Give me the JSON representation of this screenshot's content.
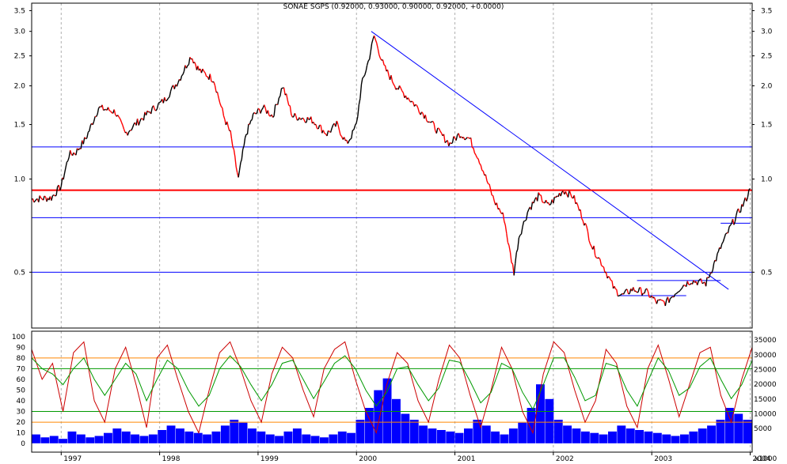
{
  "title": "SONAE SGPS (0.92000, 0.93000, 0.90000, 0.92000, +0.0000)",
  "colors": {
    "price_up": "#000000",
    "price_down": "#ff0000",
    "trendline": "#0000ff",
    "resistance": "#ff0000",
    "stoch_k": "#cc0000",
    "stoch_d": "#009900",
    "volume": "#0000ff",
    "vol_ref_80": "#ff0000",
    "vol_ref_20": "#ff8800",
    "grid": "#b0b0b0"
  },
  "chart_data": [
    {
      "type": "line",
      "scale": "log",
      "title": "SONAE SGPS (0.92000, 0.93000, 0.90000, 0.92000, +0.0000)",
      "y_ticks": [
        "3.5",
        "3.0",
        "2.5",
        "2.0",
        "1.5",
        "1.0",
        "0.5"
      ],
      "y_tick_values": [
        3.5,
        3.0,
        2.5,
        2.0,
        1.5,
        1.0,
        0.5
      ],
      "ylim": [
        0.33,
        3.7
      ],
      "xlim": [
        1996.7,
        2004.02
      ],
      "x_ticks": [
        "1997",
        "1998",
        "1999",
        "2000",
        "2001",
        "2002",
        "2003",
        "2004"
      ],
      "x_tick_values": [
        1997,
        1998,
        1999,
        2000,
        2001,
        2002,
        2003,
        2004
      ],
      "series": [
        {
          "values": [
            [
              1996.7,
              0.86
            ],
            [
              1996.9,
              0.87
            ],
            [
              1997.0,
              0.95
            ],
            [
              1997.08,
              1.2
            ],
            [
              1997.15,
              1.22
            ],
            [
              1997.25,
              1.35
            ],
            [
              1997.38,
              1.7
            ],
            [
              1997.55,
              1.65
            ],
            [
              1997.65,
              1.4
            ],
            [
              1997.75,
              1.5
            ],
            [
              1997.9,
              1.65
            ],
            [
              1998.05,
              1.8
            ],
            [
              1998.2,
              2.1
            ],
            [
              1998.32,
              2.5
            ],
            [
              1998.4,
              2.25
            ],
            [
              1998.55,
              2.1
            ],
            [
              1998.65,
              1.6
            ],
            [
              1998.72,
              1.4
            ],
            [
              1998.8,
              1.0
            ],
            [
              1998.88,
              1.4
            ],
            [
              1998.95,
              1.6
            ],
            [
              1999.05,
              1.7
            ],
            [
              1999.15,
              1.6
            ],
            [
              1999.25,
              2.0
            ],
            [
              1999.35,
              1.6
            ],
            [
              1999.55,
              1.55
            ],
            [
              1999.7,
              1.4
            ],
            [
              1999.8,
              1.5
            ],
            [
              1999.9,
              1.3
            ],
            [
              1999.96,
              1.4
            ],
            [
              2000.0,
              1.5
            ],
            [
              2000.05,
              2.0
            ],
            [
              2000.12,
              2.4
            ],
            [
              2000.18,
              2.9
            ],
            [
              2000.28,
              2.3
            ],
            [
              2000.4,
              2.0
            ],
            [
              2000.55,
              1.8
            ],
            [
              2000.7,
              1.6
            ],
            [
              2000.85,
              1.4
            ],
            [
              2000.95,
              1.3
            ],
            [
              2001.05,
              1.4
            ],
            [
              2001.15,
              1.35
            ],
            [
              2001.25,
              1.15
            ],
            [
              2001.4,
              0.85
            ],
            [
              2001.5,
              0.75
            ],
            [
              2001.55,
              0.6
            ],
            [
              2001.6,
              0.5
            ],
            [
              2001.65,
              0.65
            ],
            [
              2001.75,
              0.8
            ],
            [
              2001.85,
              0.88
            ],
            [
              2001.95,
              0.82
            ],
            [
              2002.1,
              0.92
            ],
            [
              2002.2,
              0.88
            ],
            [
              2002.3,
              0.75
            ],
            [
              2002.4,
              0.6
            ],
            [
              2002.5,
              0.53
            ],
            [
              2002.62,
              0.44
            ],
            [
              2002.7,
              0.42
            ],
            [
              2002.8,
              0.44
            ],
            [
              2002.95,
              0.43
            ],
            [
              2003.05,
              0.4
            ],
            [
              2003.15,
              0.4
            ],
            [
              2003.3,
              0.45
            ],
            [
              2003.4,
              0.47
            ],
            [
              2003.55,
              0.46
            ],
            [
              2003.62,
              0.52
            ],
            [
              2003.7,
              0.6
            ],
            [
              2003.8,
              0.7
            ],
            [
              2003.88,
              0.78
            ],
            [
              2003.95,
              0.85
            ],
            [
              2004.0,
              0.93
            ]
          ]
        }
      ],
      "annotations": [
        {
          "kind": "trendline",
          "from": [
            2000.15,
            3.0
          ],
          "to": [
            2003.78,
            0.44
          ]
        },
        {
          "kind": "hline",
          "y": 0.92,
          "color": "#ff0000"
        },
        {
          "kind": "hline",
          "y": 1.27,
          "color": "#0000ff"
        },
        {
          "kind": "hline",
          "y": 0.75,
          "color": "#0000ff"
        },
        {
          "kind": "hline",
          "y": 0.5,
          "color": "#0000ff"
        },
        {
          "kind": "hline",
          "y": 0.47,
          "from": 2002.85,
          "to": 2003.7
        },
        {
          "kind": "hline",
          "y": 0.42,
          "from": 2002.65,
          "to": 2003.35
        },
        {
          "kind": "hline",
          "y": 0.72,
          "from": 2003.7,
          "to": 2004.0
        }
      ]
    },
    {
      "type": "line",
      "name": "oscillator",
      "y_ticks": [
        "100",
        "90",
        "80",
        "70",
        "60",
        "50",
        "40",
        "30",
        "20",
        "10",
        "0"
      ],
      "y_tick_values": [
        100,
        90,
        80,
        70,
        60,
        50,
        40,
        30,
        20,
        10,
        0
      ],
      "ylim": [
        -8,
        105
      ],
      "reference_lines": [
        80,
        70,
        30,
        20
      ],
      "series": [
        {
          "values": [
            88,
            60,
            75,
            30,
            85,
            95,
            40,
            20,
            70,
            90,
            55,
            15,
            80,
            92,
            60,
            30,
            10,
            50,
            85,
            95,
            70,
            40,
            20,
            65,
            90,
            80,
            50,
            25,
            70,
            88,
            95,
            60,
            30,
            10,
            55,
            85,
            75,
            40,
            20,
            60,
            92,
            80,
            45,
            15,
            50,
            90,
            70,
            30,
            10,
            65,
            95,
            85,
            50,
            20,
            40,
            88,
            75,
            35,
            15,
            70,
            92,
            60,
            25,
            55,
            85,
            90,
            45,
            20,
            60,
            90
          ]
        },
        {
          "values": [
            80,
            70,
            65,
            55,
            70,
            80,
            60,
            45,
            60,
            75,
            65,
            40,
            60,
            78,
            70,
            50,
            35,
            45,
            70,
            82,
            72,
            55,
            40,
            55,
            75,
            78,
            60,
            42,
            58,
            75,
            82,
            70,
            50,
            35,
            48,
            70,
            72,
            55,
            40,
            52,
            78,
            76,
            58,
            38,
            48,
            75,
            70,
            48,
            32,
            55,
            80,
            80,
            62,
            40,
            45,
            75,
            72,
            50,
            35,
            58,
            80,
            68,
            45,
            52,
            72,
            80,
            60,
            42,
            55,
            78
          ]
        }
      ]
    },
    {
      "type": "bar",
      "name": "volume",
      "y_ticks": [
        "35000",
        "30000",
        "25000",
        "20000",
        "15000",
        "10000",
        "5000"
      ],
      "y_tick_values": [
        35000,
        30000,
        25000,
        20000,
        15000,
        10000,
        5000
      ],
      "unit_label": "x1000",
      "ylim": [
        -3000,
        38000
      ],
      "values": [
        3000,
        2000,
        2500,
        1500,
        4000,
        3000,
        2000,
        2500,
        3500,
        5000,
        4000,
        3000,
        2500,
        3000,
        4500,
        6000,
        5000,
        4000,
        3500,
        3000,
        4000,
        6000,
        8000,
        7000,
        5000,
        4000,
        3000,
        2500,
        4000,
        5000,
        3000,
        2500,
        2000,
        3000,
        4000,
        3500,
        8000,
        12000,
        18000,
        22000,
        15000,
        10000,
        8000,
        6000,
        5000,
        4500,
        4000,
        3500,
        5000,
        8000,
        6000,
        4000,
        3000,
        5000,
        7000,
        12000,
        20000,
        15000,
        8000,
        6000,
        5000,
        4000,
        3500,
        3000,
        4000,
        6000,
        5000,
        4500,
        4000,
        3500,
        3000,
        2500,
        3000,
        4000,
        5000,
        6000,
        8000,
        12000,
        10000,
        8000
      ]
    }
  ]
}
